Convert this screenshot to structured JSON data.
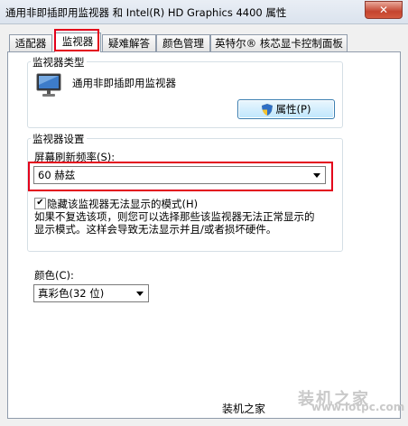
{
  "window": {
    "title": "通用非即插即用监视器 和 Intel(R) HD Graphics 4400 属性",
    "close_glyph": "✕"
  },
  "tabs": [
    {
      "label": "适配器"
    },
    {
      "label": "监视器",
      "active": true
    },
    {
      "label": "疑难解答"
    },
    {
      "label": "颜色管理"
    },
    {
      "label": "英特尔® 核芯显卡控制面板"
    }
  ],
  "monitor_type": {
    "group_label": "监视器类型",
    "monitor_name": "通用非即插即用监视器",
    "properties_button": "属性(P)",
    "icon": "monitor-icon"
  },
  "monitor_settings": {
    "group_label": "监视器设置",
    "refresh_label": "屏幕刷新频率(S):",
    "refresh_value": "60 赫兹",
    "hide_modes_label": "隐藏该监视器无法显示的模式(H)",
    "hide_modes_checked": true,
    "check_glyph": "✔",
    "description_line1": "如果不复选该项，则您可以选择那些该监视器无法正常显示的",
    "description_line2": "显示模式。这样会导致无法显示并且/或者损坏硬件。"
  },
  "color": {
    "label": "颜色(C):",
    "value": "真彩色(32 位)"
  },
  "watermark": {
    "text": "装机之家",
    "url": "www.lotpc.com",
    "site": "装机之家"
  },
  "colors": {
    "highlight": "#e3001b",
    "button_border": "#3c7fb1"
  }
}
